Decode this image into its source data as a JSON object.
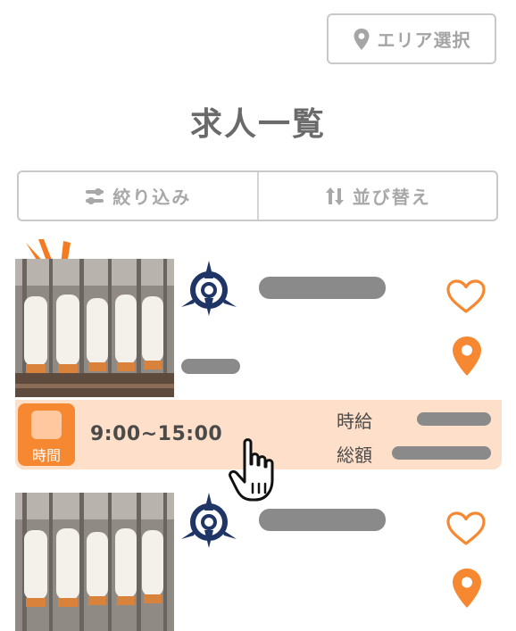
{
  "header": {
    "area_button_label": "エリア選択"
  },
  "page": {
    "title": "求人一覧"
  },
  "filters": {
    "filter_label": "絞り込み",
    "sort_label": "並び替え"
  },
  "listings": [
    {
      "time_badge_label": "時間",
      "hours": "9:00~15:00",
      "wage_label": "時給",
      "total_label": "総額"
    },
    {}
  ],
  "colors": {
    "accent": "#f68831",
    "strip": "#fedfc9",
    "placeholder": "#8a8a8a",
    "logo": "#1f3566"
  }
}
